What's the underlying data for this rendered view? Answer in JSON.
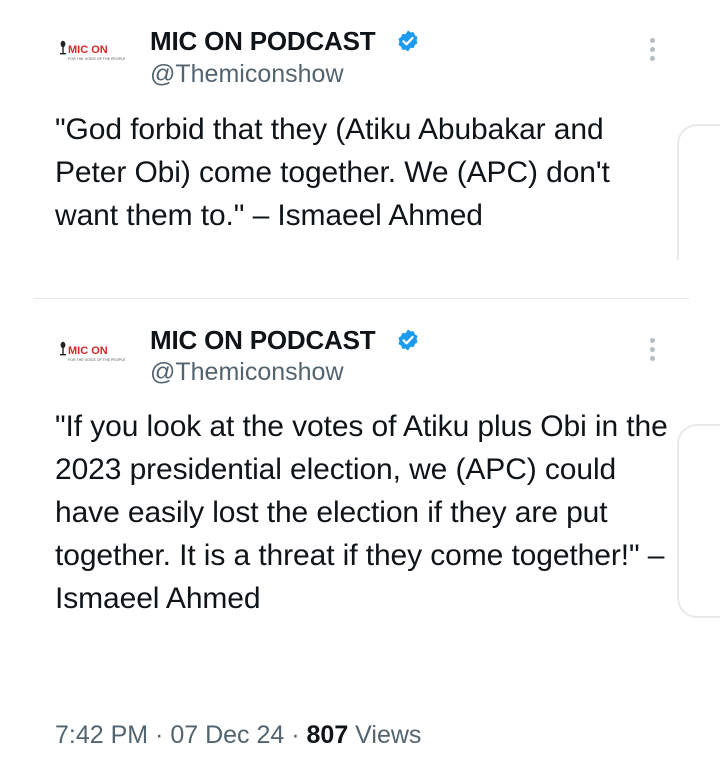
{
  "tweets": [
    {
      "author": {
        "display_name": "MIC ON PODCAST",
        "handle": "@Themiconshow",
        "verified": true,
        "avatar_logo_text": "MIC ON",
        "avatar_tagline": "FOR THE VOICE OF THE PEOPLE"
      },
      "text": "\"God forbid that they (Atiku Abubakar and Peter Obi) come together. We (APC) don't want them to.\"  – Ismaeel Ahmed"
    },
    {
      "author": {
        "display_name": "MIC ON PODCAST",
        "handle": "@Themiconshow",
        "verified": true,
        "avatar_logo_text": "MIC ON",
        "avatar_tagline": "FOR THE VOICE OF THE PEOPLE"
      },
      "text": "\"If you look at the votes of Atiku plus Obi in the 2023 presidential election, we (APC) could have easily lost the election if they are put together. It is a threat if they come together!\" – Ismaeel Ahmed"
    }
  ],
  "meta": {
    "time": "7:42 PM",
    "separator": " · ",
    "date": "07 Dec 24",
    "views_count": "807",
    "views_label": " Views"
  },
  "colors": {
    "text_primary": "#0f1419",
    "text_secondary": "#536471",
    "verified_blue": "#1d9bf0",
    "logo_red": "#d62828",
    "divider": "#e3e7ea"
  },
  "icons": {
    "verified": "verified-badge-icon",
    "more": "more-options-icon",
    "mic": "microphone-icon"
  }
}
